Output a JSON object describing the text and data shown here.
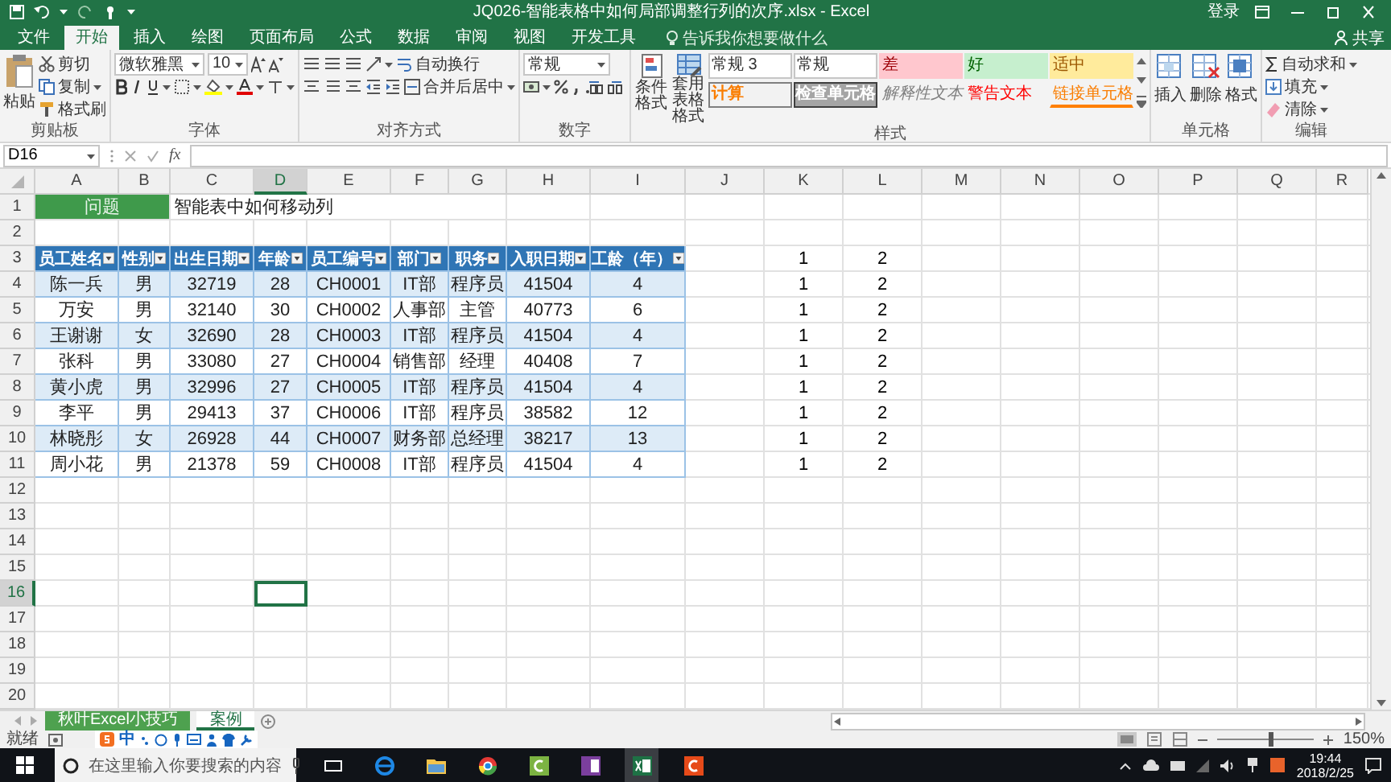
{
  "title_bar": {
    "title": "JQ026-智能表格中如何局部调整行列的次序.xlsx  -  Excel",
    "sign_in": "登录"
  },
  "ribbon_tabs": [
    {
      "label": "文件",
      "selected": false
    },
    {
      "label": "开始",
      "selected": true
    },
    {
      "label": "插入",
      "selected": false
    },
    {
      "label": "绘图",
      "selected": false
    },
    {
      "label": "页面布局",
      "selected": false
    },
    {
      "label": "公式",
      "selected": false
    },
    {
      "label": "数据",
      "selected": false
    },
    {
      "label": "审阅",
      "selected": false
    },
    {
      "label": "视图",
      "selected": false
    },
    {
      "label": "开发工具",
      "selected": false
    }
  ],
  "tell_me": {
    "placeholder": "告诉我你想要做什么"
  },
  "share": "共享",
  "clipboard": {
    "label": "剪贴板",
    "paste": "粘贴",
    "items": [
      "剪切",
      "复制",
      "格式刷"
    ]
  },
  "font": {
    "label": "字体",
    "family": "微软雅黑",
    "size": "10"
  },
  "alignment": {
    "label": "对齐方式",
    "wrap": "自动换行",
    "merge": "合并后居中"
  },
  "number": {
    "label": "数字",
    "format": "常规"
  },
  "styles": {
    "label": "样式",
    "buttons": [
      "条件格式",
      "套用表格格式"
    ],
    "gallery": [
      {
        "text": "常规 3",
        "kind": "normal"
      },
      {
        "text": "常规",
        "kind": "normal"
      },
      {
        "text": "差",
        "kind": "bad"
      },
      {
        "text": "好",
        "kind": "good"
      },
      {
        "text": "适中",
        "kind": "neutral"
      },
      {
        "text": "计算",
        "kind": "calc"
      },
      {
        "text": "检查单元格",
        "kind": "check"
      },
      {
        "text": "解释性文本",
        "kind": "explanatory"
      },
      {
        "text": "警告文本",
        "kind": "warning"
      },
      {
        "text": "链接单元格",
        "kind": "linked"
      }
    ]
  },
  "cells": {
    "label": "单元格",
    "buttons": [
      "插入",
      "删除",
      "格式"
    ]
  },
  "editing": {
    "label": "编辑",
    "items": [
      "自动求和",
      "填充",
      "清除"
    ]
  },
  "formula_bar": {
    "name_box": "D16",
    "function_button": "fx"
  },
  "columns": [
    {
      "label": "A",
      "selected": false
    },
    {
      "label": "B",
      "selected": false
    },
    {
      "label": "C",
      "selected": false
    },
    {
      "label": "D",
      "selected": true
    },
    {
      "label": "E",
      "selected": false
    },
    {
      "label": "F",
      "selected": false
    },
    {
      "label": "G",
      "selected": false
    },
    {
      "label": "H",
      "selected": false
    },
    {
      "label": "I",
      "selected": false
    },
    {
      "label": "J",
      "selected": false
    },
    {
      "label": "K",
      "selected": false
    },
    {
      "label": "L",
      "selected": false
    },
    {
      "label": "M",
      "selected": false
    },
    {
      "label": "N",
      "selected": false
    },
    {
      "label": "O",
      "selected": false
    },
    {
      "label": "P",
      "selected": false
    },
    {
      "label": "Q",
      "selected": false
    },
    {
      "label": "R",
      "selected": false
    }
  ],
  "rows": [
    {
      "label": "1",
      "selected": false
    },
    {
      "label": "2",
      "selected": false
    },
    {
      "label": "3",
      "selected": false
    },
    {
      "label": "4",
      "selected": false
    },
    {
      "label": "5",
      "selected": false
    },
    {
      "label": "6",
      "selected": false
    },
    {
      "label": "7",
      "selected": false
    },
    {
      "label": "8",
      "selected": false
    },
    {
      "label": "9",
      "selected": false
    },
    {
      "label": "10",
      "selected": false
    },
    {
      "label": "11",
      "selected": false
    },
    {
      "label": "12",
      "selected": false
    },
    {
      "label": "13",
      "selected": false
    },
    {
      "label": "14",
      "selected": false
    },
    {
      "label": "15",
      "selected": false
    },
    {
      "label": "16",
      "selected": true
    },
    {
      "label": "17",
      "selected": false
    },
    {
      "label": "18",
      "selected": false
    },
    {
      "label": "19",
      "selected": false
    },
    {
      "label": "20",
      "selected": false
    }
  ],
  "banner": {
    "label": "问题",
    "text": "智能表中如何移动列"
  },
  "table": {
    "headers": [
      "员工姓名",
      "性别",
      "出生日期",
      "年龄",
      "员工编号",
      "部门",
      "职务",
      "入职日期",
      "工龄（年）"
    ],
    "rows": [
      [
        "陈一兵",
        "男",
        "32719",
        "28",
        "CH0001",
        "IT部",
        "程序员",
        "41504",
        "4"
      ],
      [
        "万安",
        "男",
        "32140",
        "30",
        "CH0002",
        "人事部",
        "主管",
        "40773",
        "6"
      ],
      [
        "王谢谢",
        "女",
        "32690",
        "28",
        "CH0003",
        "IT部",
        "程序员",
        "41504",
        "4"
      ],
      [
        "张科",
        "男",
        "33080",
        "27",
        "CH0004",
        "销售部",
        "经理",
        "40408",
        "7"
      ],
      [
        "黄小虎",
        "男",
        "32996",
        "27",
        "CH0005",
        "IT部",
        "程序员",
        "41504",
        "4"
      ],
      [
        "李平",
        "男",
        "29413",
        "37",
        "CH0006",
        "IT部",
        "程序员",
        "38582",
        "12"
      ],
      [
        "林晓彤",
        "女",
        "26928",
        "44",
        "CH0007",
        "财务部",
        "总经理",
        "38217",
        "13"
      ],
      [
        "周小花",
        "男",
        "21378",
        "59",
        "CH0008",
        "IT部",
        "程序员",
        "41504",
        "4"
      ]
    ]
  },
  "side_values": [
    [
      "1",
      "2"
    ],
    [
      "1",
      "2"
    ],
    [
      "1",
      "2"
    ],
    [
      "1",
      "2"
    ],
    [
      "1",
      "2"
    ],
    [
      "1",
      "2"
    ],
    [
      "1",
      "2"
    ],
    [
      "1",
      "2"
    ],
    [
      "1",
      "2"
    ]
  ],
  "sheet_tabs": [
    {
      "label": "秋叶Excel小技巧",
      "selected": false,
      "color": "#4ea14f"
    },
    {
      "label": "案例",
      "selected": true
    }
  ],
  "ime_toolbar": {
    "mode": "中"
  },
  "status_bar": {
    "status": "就绪",
    "zoom": "150%",
    "zoom_slider": {
      "level": 0.55
    }
  },
  "taskbar": {
    "search": {
      "placeholder": "在这里输入你要搜索的内容"
    },
    "time": "19:44",
    "date": "2018/2/25"
  }
}
